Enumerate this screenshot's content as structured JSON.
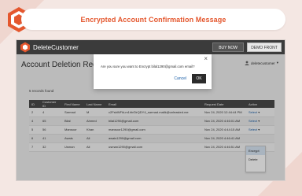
{
  "banner": {
    "title": "Encrypted Account Confirmation Message"
  },
  "app": {
    "title": "DeleteCustomer",
    "buy_now": "BUY NOW",
    "demo_front": "DEMO FRONT",
    "admin_label": "deletecustomer"
  },
  "page": {
    "title": "Account Deletion Reque",
    "records_found": "5 records found"
  },
  "table": {
    "headers": [
      "ID",
      "Customer ID",
      "First Name",
      "Last Name",
      "Email",
      "Request Date",
      "Action"
    ],
    "rows": [
      {
        "id": "2",
        "customer_id": "4",
        "first_name": "Sarmad",
        "last_name": "M",
        "email": "c2FsbWFkLm1hbGlrQDY4_sarmad.malik@unleasted.me",
        "date": "Nov 24, 2020 12:44:44 PM",
        "action": "Select"
      },
      {
        "id": "4",
        "customer_id": "65",
        "first_name": "Bilal",
        "last_name": "Ahmed",
        "email": "bilal1290@gmail.com",
        "date": "Nov 24, 2020 4:46:01 AM",
        "action": "Select"
      },
      {
        "id": "5",
        "customer_id": "56",
        "first_name": "Mansoor",
        "last_name": "Khan",
        "email": "mansoor1290@gmail.com",
        "date": "Nov 24, 2020 4:44:15 AM",
        "action": "Select"
      },
      {
        "id": "6",
        "customer_id": "41",
        "first_name": "Awais",
        "last_name": "Ali",
        "email": "awais1290@gmail.com",
        "date": "Nov 24, 2020 4:46:41 AM",
        "action": "Select"
      },
      {
        "id": "7",
        "customer_id": "32",
        "first_name": "Usman",
        "last_name": "Ali",
        "email": "usman1290@gmail.com",
        "date": "Nov 24, 2020 4:46:51 AM",
        "action": "Select"
      }
    ]
  },
  "dropdown": {
    "items": [
      "Encrypt",
      "Delete"
    ]
  },
  "modal": {
    "message": "Are you sure you want to Encrypt bilal1290@gmail.com email?",
    "close": "×",
    "cancel": "Cancel",
    "ok": "OK"
  },
  "colors": {
    "accent": "#e4572e",
    "topbar": "#3b3b3b",
    "link": "#1a5fa8"
  }
}
